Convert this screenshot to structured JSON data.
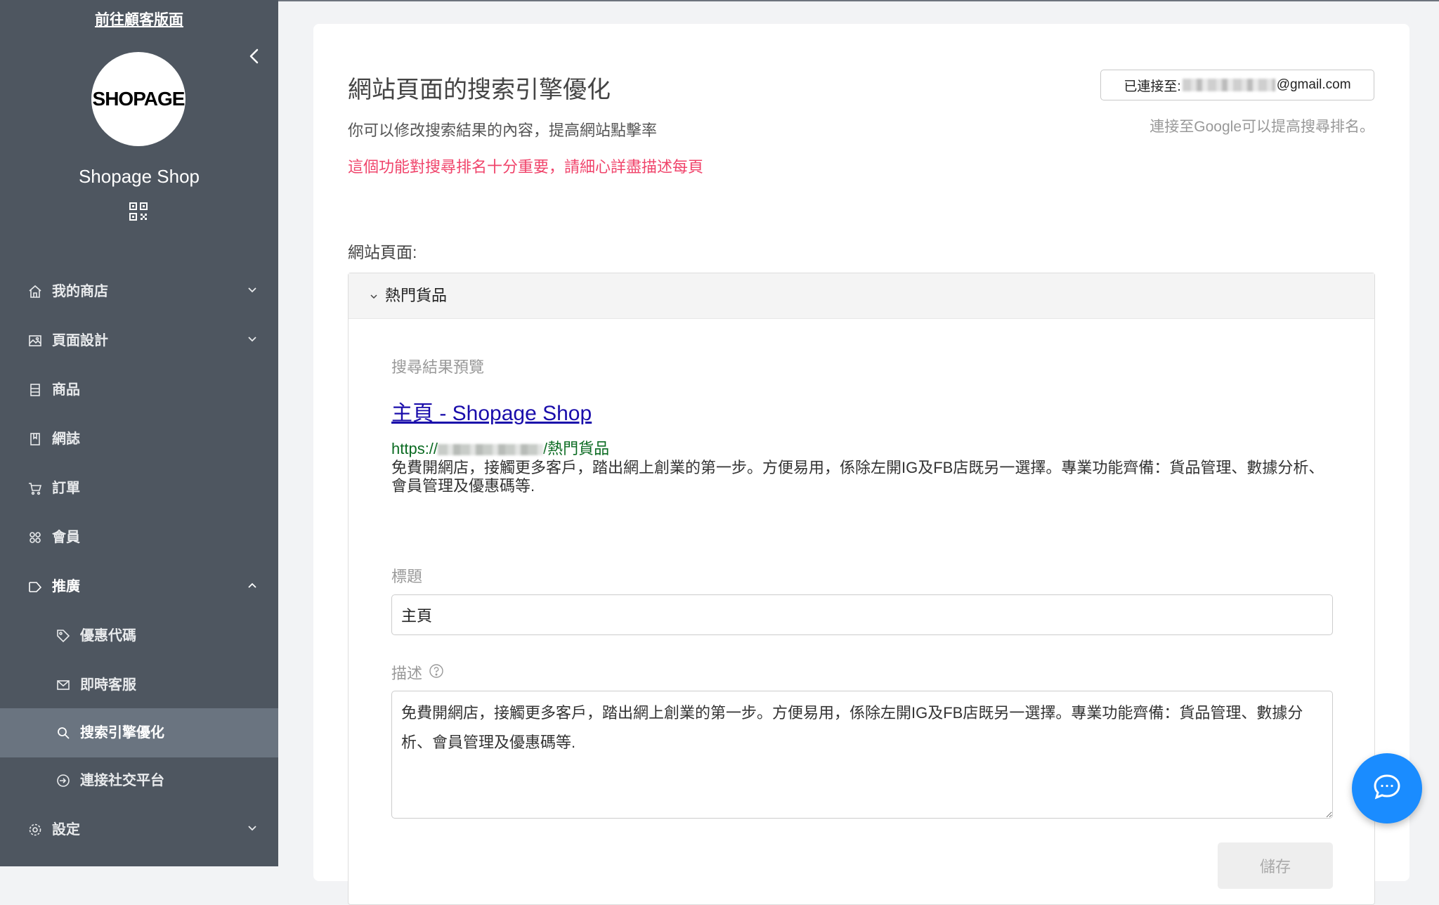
{
  "sidebar": {
    "visit_link": "前往顧客版面",
    "logo_text": "SHOPAGE",
    "shop_name": "Shopage Shop",
    "items": [
      {
        "label": "我的商店",
        "icon": "home-icon"
      },
      {
        "label": "頁面設計",
        "icon": "image-icon"
      },
      {
        "label": "商品",
        "icon": "product-icon"
      },
      {
        "label": "網誌",
        "icon": "blog-icon"
      },
      {
        "label": "訂單",
        "icon": "cart-icon"
      },
      {
        "label": "會員",
        "icon": "members-icon"
      },
      {
        "label": "推廣",
        "icon": "promotion-icon",
        "expanded": true
      },
      {
        "label": "優惠代碼",
        "icon": "tag-icon"
      },
      {
        "label": "即時客服",
        "icon": "mail-icon"
      },
      {
        "label": "搜索引擎優化",
        "icon": "search-icon",
        "active": true
      },
      {
        "label": "連接社交平台",
        "icon": "connect-icon"
      },
      {
        "label": "設定",
        "icon": "gear-icon"
      }
    ]
  },
  "header": {
    "title": "網站頁面的搜索引擎優化",
    "subtitle": "你可以修改搜索結果的內容，提高網站點擊率",
    "warning": "這個功能對搜尋排名十分重要，請細心詳盡描述每頁",
    "google_prefix": "已連接至:",
    "google_email_suffix": "@gmail.com",
    "google_hint": "連接至Google可以提高搜尋排名。"
  },
  "main": {
    "pages_label": "網站頁面:",
    "panel_title": "熱門貨品",
    "preview": {
      "label": "搜尋結果預覽",
      "title": "主頁 - Shopage Shop",
      "url_prefix": "https://",
      "url_path": "/熱門貨品",
      "description": "免費開網店，接觸更多客戶，踏出網上創業的第一步。方便易用，係除左開IG及FB店既另一選擇。專業功能齊備：貨品管理、數據分析、會員管理及優惠碼等."
    },
    "title_field": {
      "label": "標題",
      "value": "主頁"
    },
    "description_field": {
      "label": "描述",
      "value": "免費開網店，接觸更多客戶，踏出網上創業的第一步。方便易用，係除左開IG及FB店既另一選擇。專業功能齊備：貨品管理、數據分析、會員管理及優惠碼等."
    },
    "save_label": "儲存"
  },
  "colors": {
    "sidebar_bg": "#4e5660",
    "sidebar_active": "#6a7480",
    "warning": "#f0446b",
    "link": "#1a0dab",
    "url_green": "#0b6b22",
    "chat_fab": "#1a8cff"
  }
}
